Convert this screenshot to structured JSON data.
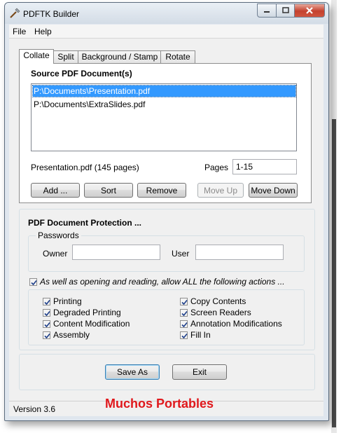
{
  "window": {
    "title": "PDFTK Builder"
  },
  "menu": [
    "File",
    "Help"
  ],
  "tabs": [
    "Collate",
    "Split",
    "Background / Stamp",
    "Rotate"
  ],
  "collate": {
    "section_title": "Source PDF Document(s)",
    "files": [
      {
        "path": "P:\\Documents\\Presentation.pdf",
        "selected": true
      },
      {
        "path": "P:\\Documents\\ExtraSlides.pdf",
        "selected": false
      }
    ],
    "selected_info": "Presentation.pdf  (145 pages)",
    "pages_label": "Pages",
    "pages_value": "1-15",
    "buttons": {
      "add": "Add ...",
      "sort": "Sort",
      "remove": "Remove",
      "move_up": "Move Up",
      "move_down": "Move Down"
    }
  },
  "protection": {
    "title": "PDF Document Protection ...",
    "passwords_label": "Passwords",
    "owner_label": "Owner",
    "owner_value": "",
    "user_label": "User",
    "user_value": "",
    "allow_all_label": "As well as opening and reading, allow ALL the following actions ...",
    "allow_all_checked": true,
    "permissions_left": [
      "Printing",
      "Degraded Printing",
      "Content Modification",
      "Assembly"
    ],
    "permissions_right": [
      "Copy Contents",
      "Screen Readers",
      "Annotation Modifications",
      "Fill In"
    ]
  },
  "actions": {
    "save_as": "Save As",
    "exit": "Exit"
  },
  "status": {
    "version": "Version 3.6"
  },
  "watermark": "Muchos Portables"
}
